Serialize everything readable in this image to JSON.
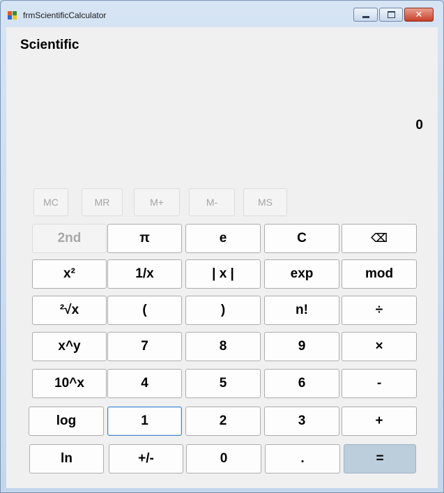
{
  "window": {
    "title": "frmScientificCalculator"
  },
  "calculator": {
    "mode_title": "Scientific",
    "display_value": "0"
  },
  "memory": {
    "mc": "MC",
    "mr": "MR",
    "mplus": "M+",
    "mminus": "M-",
    "ms": "MS"
  },
  "keys": {
    "second": "2nd",
    "pi": "π",
    "e": "e",
    "clear": "C",
    "backspace": "⌫",
    "square": "x²",
    "reciprocal": "1/x",
    "abs": "| x |",
    "exp": "exp",
    "mod": "mod",
    "sqrt": "²√x",
    "lparen": "(",
    "rparen": ")",
    "factorial": "n!",
    "divide": "÷",
    "power": "x^y",
    "d7": "7",
    "d8": "8",
    "d9": "9",
    "multiply": "×",
    "tenpow": "10^x",
    "d4": "4",
    "d5": "5",
    "d6": "6",
    "minus": "-",
    "log": "log",
    "d1": "1",
    "d2": "2",
    "d3": "3",
    "plus": "+",
    "ln": "ln",
    "negate": "+/-",
    "d0": "0",
    "decimal": ".",
    "equals": "="
  }
}
